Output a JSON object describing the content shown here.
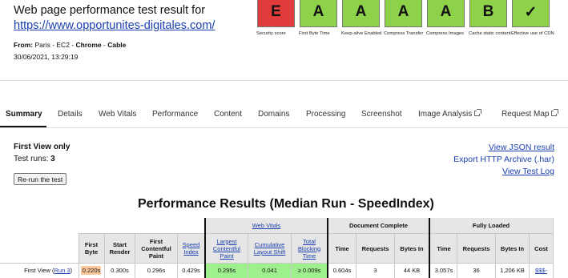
{
  "header": {
    "title": "Web page performance test result for",
    "url": "https://www.opportunites-digitales.com/",
    "from_label": "From:",
    "from_location": "Paris - EC2 -",
    "browser": "Chrome",
    "connection": "Cable",
    "from_sep": "-",
    "date": "30/06/2021, 13:29:19"
  },
  "grades": [
    {
      "letter": "E",
      "label": "Security score",
      "color": "#e03c3c"
    },
    {
      "letter": "A",
      "label": "First Byte Time",
      "color": "#8ed14a"
    },
    {
      "letter": "A",
      "label": "Keep-alive Enabled",
      "color": "#8ed14a"
    },
    {
      "letter": "A",
      "label": "Compress Transfer",
      "color": "#8ed14a"
    },
    {
      "letter": "A",
      "label": "Compress Images",
      "color": "#8ed14a"
    },
    {
      "letter": "B",
      "label": "Cache static content",
      "color": "#8ed14a"
    },
    {
      "letter": "✓",
      "label": "Effective use of CDN",
      "color": "#8ed14a"
    }
  ],
  "tabs": [
    "Summary",
    "Details",
    "Web Vitals",
    "Performance",
    "Content",
    "Domains",
    "Processing",
    "Screenshot",
    "Image Analysis",
    "Request Map"
  ],
  "test_info": {
    "first_view_only": "First View only",
    "test_runs_label": "Test runs:",
    "test_runs_value": "3",
    "rerun_button": "Re-run the test"
  },
  "result_links": [
    "View JSON result",
    "Export HTTP Archive (.har)",
    "View Test Log"
  ],
  "performance": {
    "title": "Performance Results (Median Run - SpeedIndex)",
    "group_headers": {
      "web_vitals": "Web Vitals",
      "document_complete": "Document Complete",
      "fully_loaded": "Fully Loaded"
    },
    "columns": {
      "first_byte": "First Byte",
      "start_render": "Start Render",
      "first_contentful_paint": "First Contentful Paint",
      "speed_index": "Speed Index",
      "lcp": "Largest Contentful Paint",
      "cls": "Cumulative Layout Shift",
      "tbt": "Total Blocking Time",
      "dc_time": "Time",
      "dc_requests": "Requests",
      "dc_bytes": "Bytes In",
      "fl_time": "Time",
      "fl_requests": "Requests",
      "fl_bytes": "Bytes In",
      "cost": "Cost"
    },
    "row": {
      "label": "First View",
      "run_link": "Run 3",
      "first_byte": "0.220s",
      "start_render": "0.300s",
      "first_contentful_paint": "0.296s",
      "speed_index": "0.429s",
      "lcp": "0.295s",
      "cls": "0.041",
      "tbt": "≥ 0.009s",
      "dc_time": "0.604s",
      "dc_requests": "3",
      "dc_bytes": "44 KB",
      "fl_time": "3.057s",
      "fl_requests": "36",
      "fl_bytes": "1,206 KB",
      "cost": "$$$-"
    }
  }
}
